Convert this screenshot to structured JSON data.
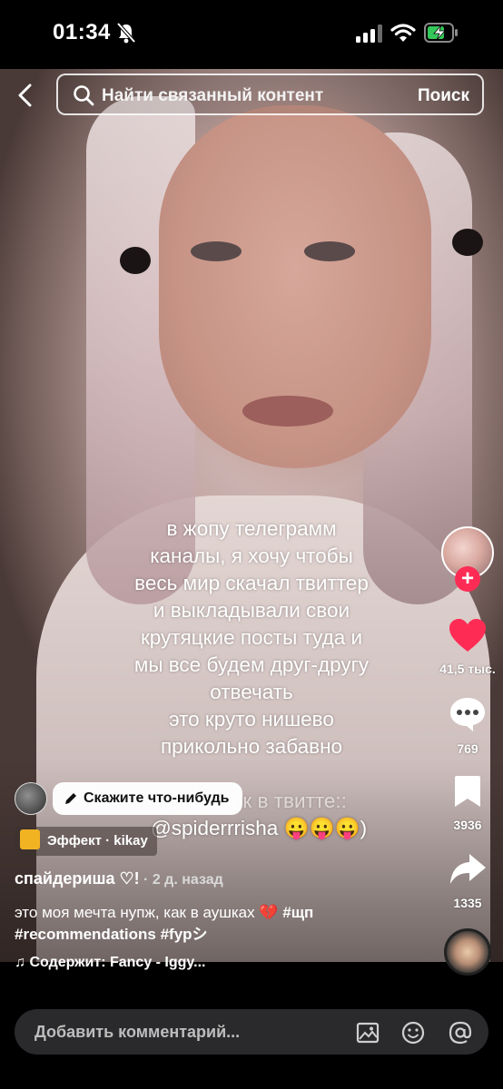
{
  "status_bar": {
    "time": "01:34"
  },
  "search": {
    "placeholder": "Найти связанный контент",
    "button": "Поиск"
  },
  "caption": {
    "lines": [
      "в жопу телеграмм",
      "каналы, я хочу чтобы",
      "весь мир скачал твиттер",
      "и выкладывали свои",
      "крутяцкие посты туда и",
      "мы все будем друг-другу",
      "отвечать",
      "это круто нишево",
      "прикольно забавно"
    ],
    "faded_line": "(мой ник в твитте::",
    "handle_line": "@spiderrrisha 😛😛😛)"
  },
  "actions": {
    "likes": "41,5 тыс.",
    "comments": "769",
    "bookmarks": "3936",
    "shares": "1335"
  },
  "meta": {
    "say_something": "Скажите что-нибудь",
    "effect": "Эффект · kikay",
    "username": "спайдериша ♡!",
    "time_ago": " · 2 д. назад",
    "description_line1": "это моя мечта нупж, как в аушках 💔 ",
    "description_tag1": "#щп",
    "description_line2": "#recommendations #fypシ",
    "sound": "♫ Содержит: Fancy - Iggy..."
  },
  "comment_bar": {
    "placeholder": "Добавить комментарий..."
  },
  "colors": {
    "like": "#fe2c55",
    "follow": "#fe2c55",
    "effect": "#f2b323"
  }
}
